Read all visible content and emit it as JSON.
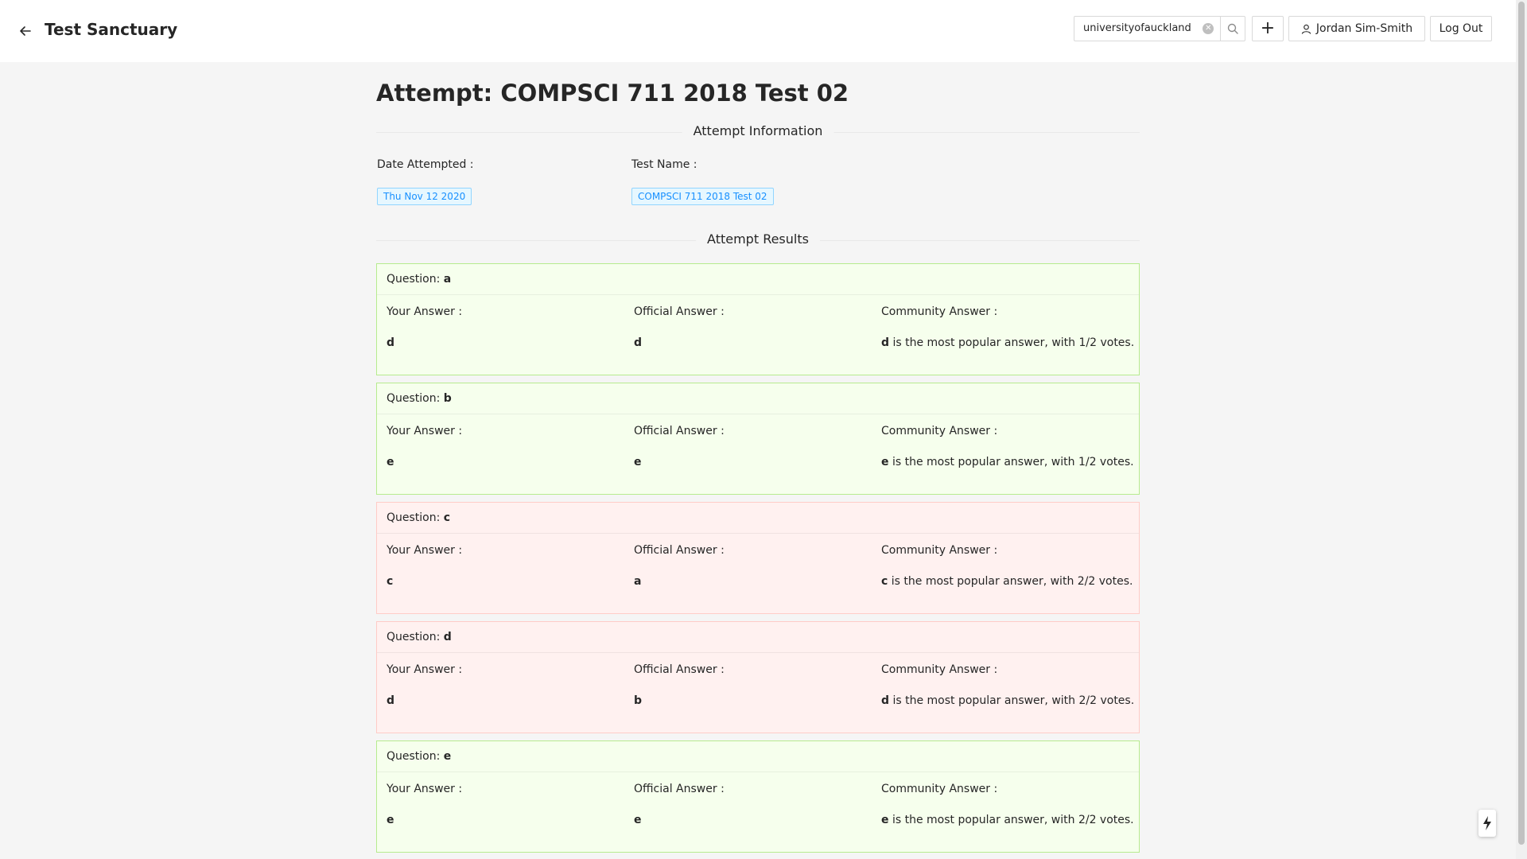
{
  "header": {
    "app_title": "Test Sanctuary",
    "search_value": "universityofauckland",
    "add_label": "+",
    "user_name": "Jordan Sim-Smith",
    "logout_label": "Log Out"
  },
  "page": {
    "title": "Attempt: COMPSCI 711 2018 Test 02",
    "info_section": "Attempt Information",
    "date_label": "Date Attempted :",
    "date_value": "Thu Nov 12 2020",
    "test_label": "Test Name :",
    "test_value": "COMPSCI 711 2018 Test 02",
    "results_section": "Attempt Results"
  },
  "labels": {
    "question": "Question: ",
    "your_answer": "Your Answer :",
    "official_answer": "Official Answer :",
    "community_answer": "Community Answer :"
  },
  "questions": [
    {
      "id": "a",
      "status": "correct",
      "your": "d",
      "official": "d",
      "community": "d",
      "community_text": " is the most popular answer, with 1/2 votes."
    },
    {
      "id": "b",
      "status": "correct",
      "your": "e",
      "official": "e",
      "community": "e",
      "community_text": " is the most popular answer, with 1/2 votes."
    },
    {
      "id": "c",
      "status": "wrong",
      "your": "c",
      "official": "a",
      "community": "c",
      "community_text": " is the most popular answer, with 2/2 votes."
    },
    {
      "id": "d",
      "status": "wrong",
      "your": "d",
      "official": "b",
      "community": "d",
      "community_text": " is the most popular answer, with 2/2 votes."
    },
    {
      "id": "e",
      "status": "correct",
      "your": "e",
      "official": "e",
      "community": "e",
      "community_text": " is the most popular answer, with 2/2 votes."
    }
  ],
  "colors": {
    "correct_bg": "#f6ffed",
    "correct_border": "#b7eb8f",
    "wrong_bg": "#fff1f0",
    "wrong_border": "#ffccc7",
    "tag_blue": "#1890ff"
  },
  "icons": {
    "back": "arrow-left-icon",
    "clear": "close-circle-icon",
    "search": "search-icon",
    "user": "user-icon",
    "float": "lightning-icon"
  }
}
